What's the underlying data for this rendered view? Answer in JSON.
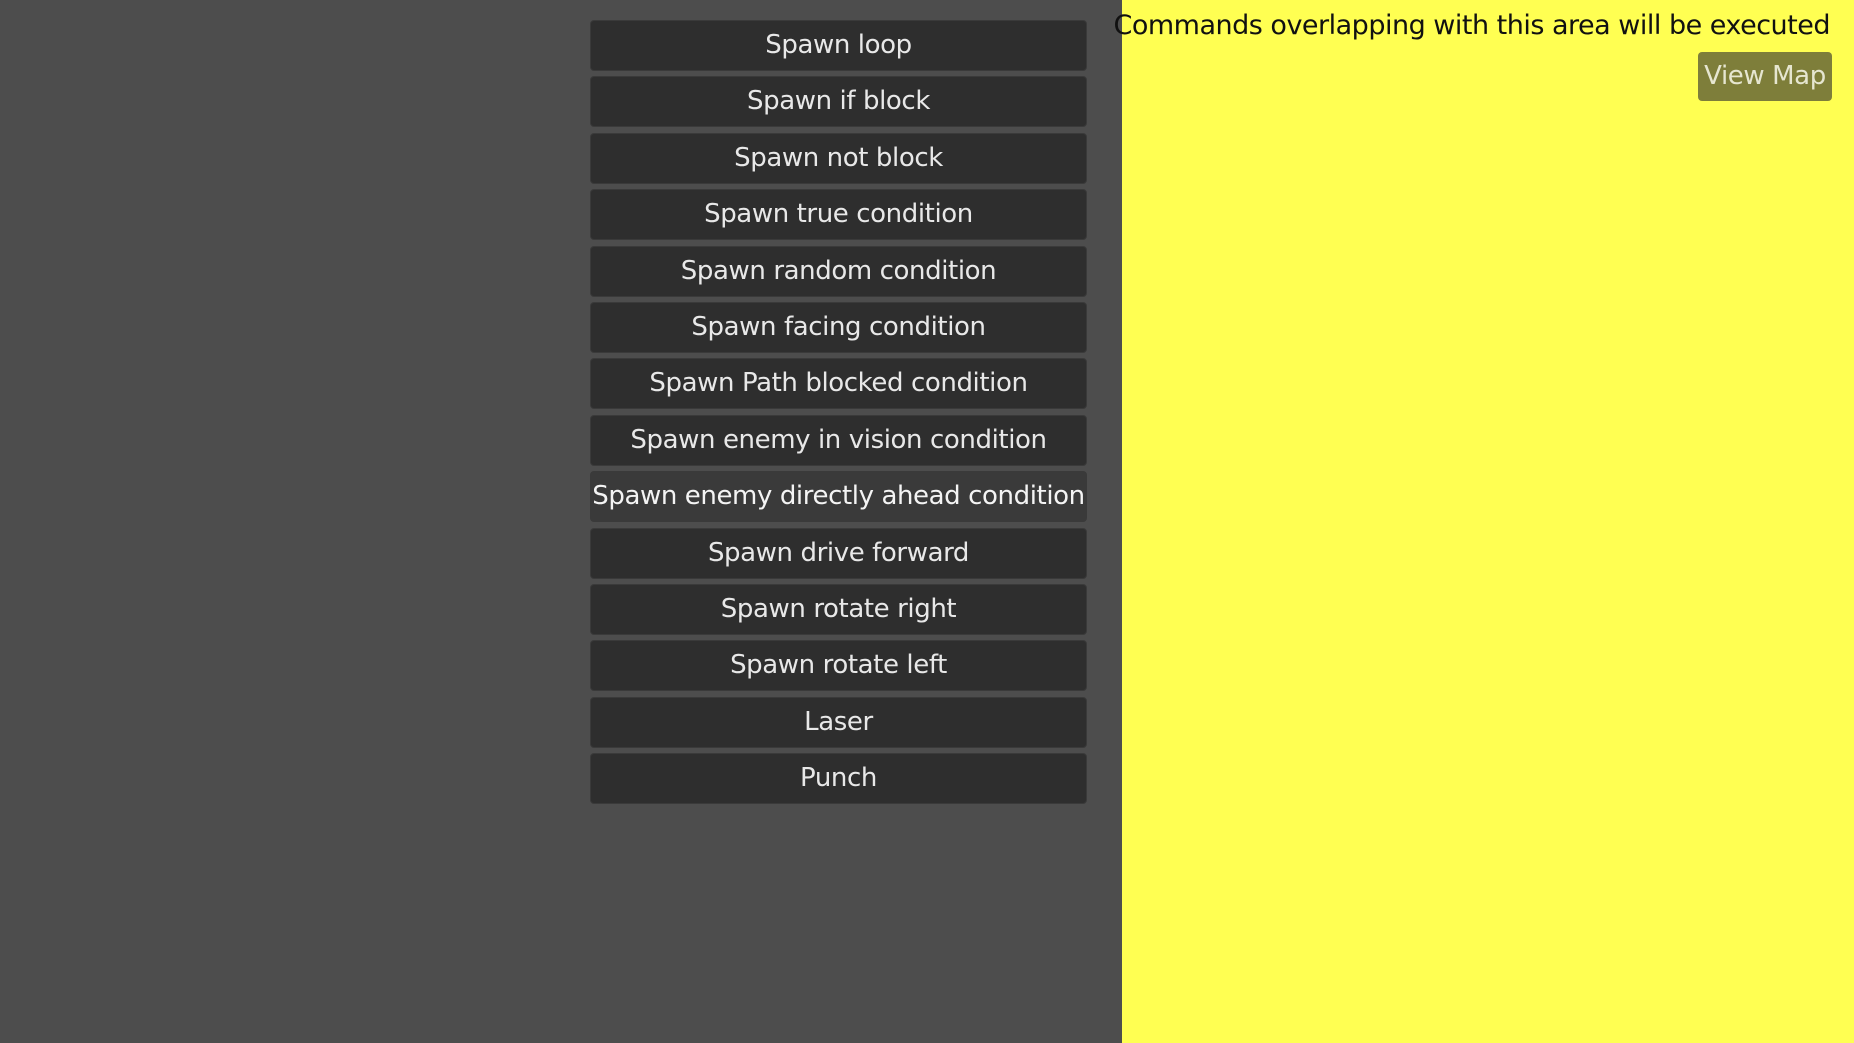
{
  "command_palette": {
    "buttons": [
      {
        "label": "Spawn loop"
      },
      {
        "label": "Spawn if block"
      },
      {
        "label": "Spawn not block"
      },
      {
        "label": "Spawn true condition"
      },
      {
        "label": "Spawn random condition"
      },
      {
        "label": "Spawn facing condition"
      },
      {
        "label": "Spawn Path blocked condition"
      },
      {
        "label": "Spawn enemy in vision condition"
      },
      {
        "label": "Spawn enemy directly ahead condition"
      },
      {
        "label": "Spawn drive forward"
      },
      {
        "label": "Spawn rotate right"
      },
      {
        "label": "Spawn rotate left"
      },
      {
        "label": "Laser"
      },
      {
        "label": "Punch"
      }
    ]
  },
  "execution_area": {
    "label": "Commands overlapping with this area will be executed",
    "view_map_label": "View Map",
    "background_color": "#ffff52"
  },
  "colors": {
    "workspace": "#4d4d4d",
    "button": "#2e2e2e",
    "button_text": "#e8e8e8",
    "view_map_button": "#7e7e3a"
  }
}
